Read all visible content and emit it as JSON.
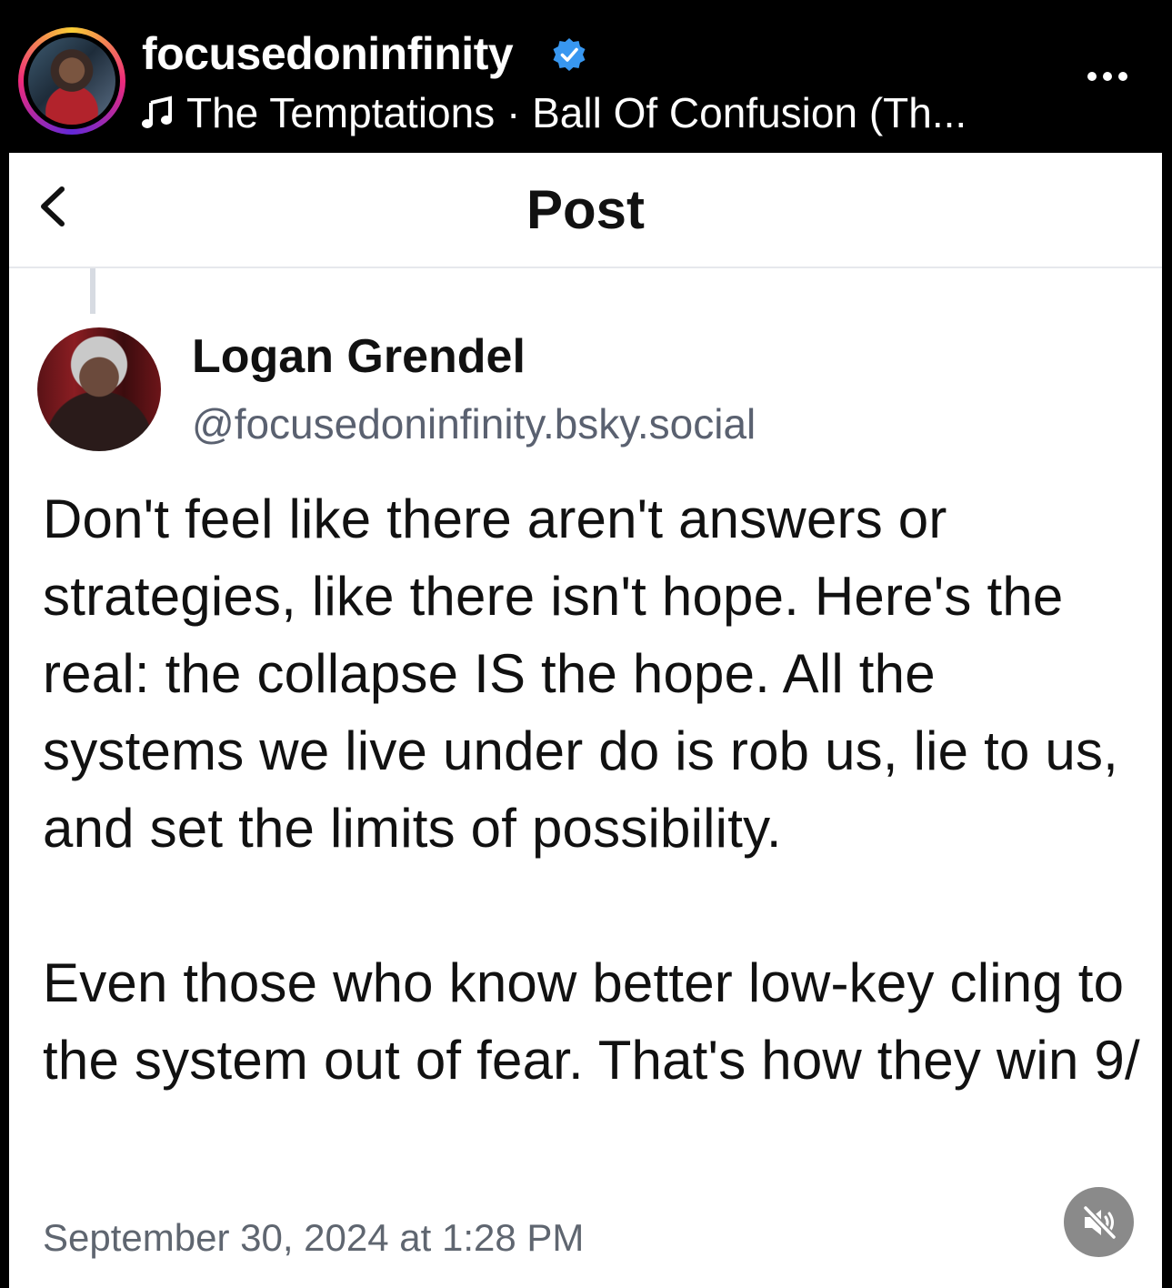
{
  "story": {
    "username": "focusedoninfinity",
    "verified": true,
    "music_track": "The Temptations · Ball Of Confusion (Th...",
    "more_label": "..."
  },
  "post": {
    "header_title": "Post",
    "author": {
      "name": "Logan Grendel",
      "handle": "@focusedoninfinity.bsky.social"
    },
    "paragraphs": [
      "Don't feel like there aren't answers or strategies, like there isn't hope. Here's the real: the collapse IS the hope. All the systems we live under do is rob us, lie to us, and set the limits of possibility.",
      "Even those who know better low-key cling to the system out of fear. That's how they win 9/"
    ],
    "timestamp": "September 30, 2024 at 1:28 PM"
  },
  "colors": {
    "verified_blue": "#3897f0",
    "mute_bg": "#8a8a8a"
  },
  "icons": [
    "verified-icon",
    "music-note-icon",
    "more-options-icon",
    "back-chevron-icon",
    "muted-speaker-icon"
  ]
}
